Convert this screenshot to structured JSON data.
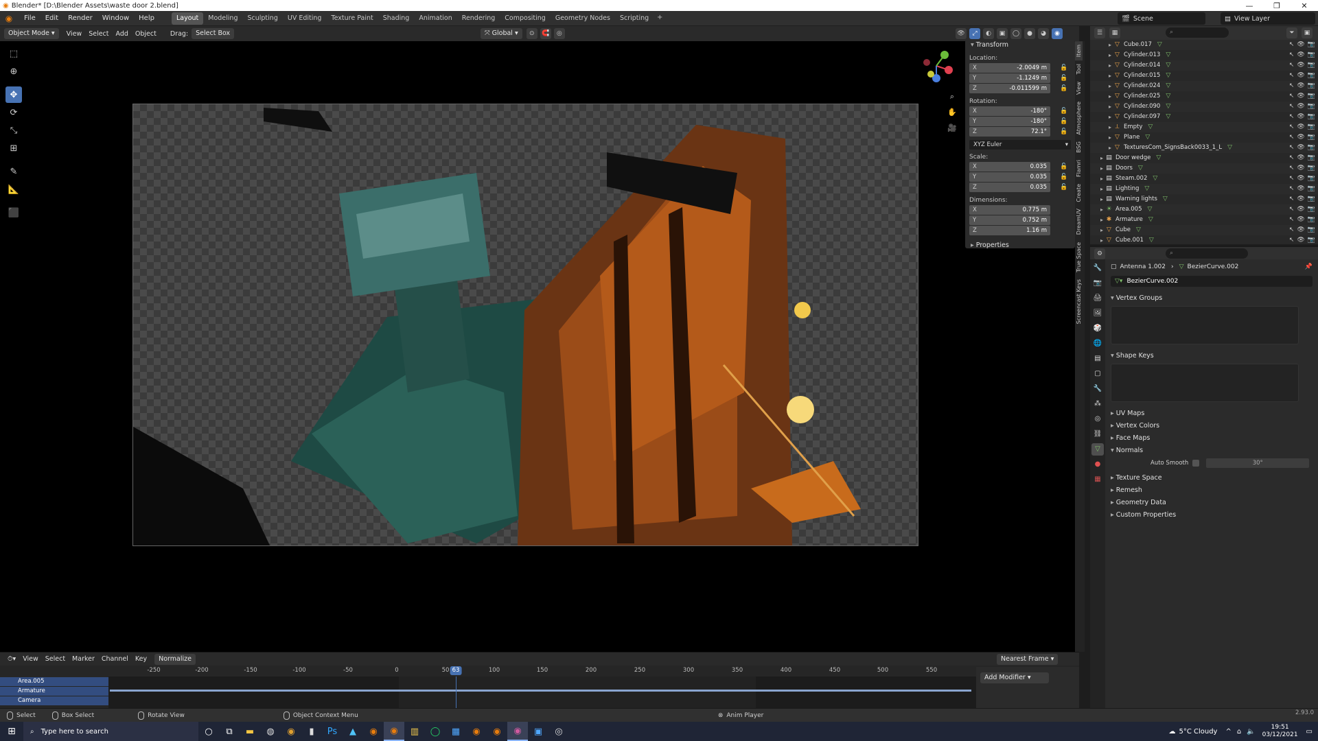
{
  "window": {
    "title": "Blender* [D:\\Blender Assets\\waste door 2.blend]",
    "controls": [
      "—",
      "❐",
      "✕"
    ]
  },
  "menu": [
    "File",
    "Edit",
    "Render",
    "Window",
    "Help"
  ],
  "workspaces": [
    "Layout",
    "Modeling",
    "Sculpting",
    "UV Editing",
    "Texture Paint",
    "Shading",
    "Animation",
    "Rendering",
    "Compositing",
    "Geometry Nodes",
    "Scripting"
  ],
  "active_workspace": "Layout",
  "scene": "Scene",
  "view_layer": "View Layer",
  "viewport_header": {
    "mode": "Object Mode",
    "view": "View",
    "select": "Select",
    "add": "Add",
    "object": "Object",
    "drag_label": "Drag:",
    "drag_value": "Select Box",
    "orientation": "Global"
  },
  "transform": {
    "title": "Transform",
    "location_label": "Location:",
    "location": [
      [
        "X",
        "-2.0049 m"
      ],
      [
        "Y",
        "-1.1249 m"
      ],
      [
        "Z",
        "-0.011599 m"
      ]
    ],
    "rotation_label": "Rotation:",
    "rotation": [
      [
        "X",
        "-180°"
      ],
      [
        "Y",
        "-180°"
      ],
      [
        "Z",
        "72.1°"
      ]
    ],
    "euler": "XYZ Euler",
    "scale_label": "Scale:",
    "scale": [
      [
        "X",
        "0.035"
      ],
      [
        "Y",
        "0.035"
      ],
      [
        "Z",
        "0.035"
      ]
    ],
    "dimensions_label": "Dimensions:",
    "dimensions": [
      [
        "X",
        "0.775 m"
      ],
      [
        "Y",
        "0.752 m"
      ],
      [
        "Z",
        "1.16 m"
      ]
    ],
    "properties": "Properties"
  },
  "side_tabs": [
    "Item",
    "Tool",
    "View",
    "Atmosphere",
    "BSG",
    "Flamri",
    "Create",
    "DreamUV",
    "True Space",
    "Screencast Keys"
  ],
  "timeline": {
    "menus": [
      "View",
      "Select",
      "Marker",
      "Channel",
      "Key"
    ],
    "normalize": "Normalize",
    "snap": "Nearest Frame",
    "ticks": [
      "-250",
      "-200",
      "-150",
      "-100",
      "-50",
      "0",
      "50",
      "100",
      "150",
      "200",
      "250",
      "300",
      "350",
      "400",
      "450",
      "500",
      "550"
    ],
    "current_frame": "63",
    "channels": [
      "Area.005",
      "Armature",
      "Camera"
    ],
    "add_modifier": "Add Modifier"
  },
  "status": {
    "select": "Select",
    "box_select": "Box Select",
    "rotate_view": "Rotate View",
    "context_menu": "Object Context Menu",
    "anim_player": "Anim Player",
    "version": "2.93.0"
  },
  "outliner": {
    "rows": [
      {
        "name": "Cube.017",
        "type": "obj",
        "indent": 2
      },
      {
        "name": "Cylinder.013",
        "type": "obj",
        "indent": 2
      },
      {
        "name": "Cylinder.014",
        "type": "obj",
        "indent": 2
      },
      {
        "name": "Cylinder.015",
        "type": "obj",
        "indent": 2
      },
      {
        "name": "Cylinder.024",
        "type": "obj",
        "indent": 2
      },
      {
        "name": "Cylinder.025",
        "type": "obj",
        "indent": 2
      },
      {
        "name": "Cylinder.090",
        "type": "obj",
        "indent": 2
      },
      {
        "name": "Cylinder.097",
        "type": "obj",
        "indent": 2
      },
      {
        "name": "Empty",
        "type": "empty",
        "indent": 2
      },
      {
        "name": "Plane",
        "type": "obj",
        "indent": 2
      },
      {
        "name": "TexturesCom_SignsBack0033_1_L",
        "type": "obj",
        "indent": 2
      },
      {
        "name": "Door wedge",
        "type": "coll",
        "indent": 1
      },
      {
        "name": "Doors",
        "type": "coll",
        "indent": 1
      },
      {
        "name": "Steam.002",
        "type": "coll",
        "indent": 1
      },
      {
        "name": "Lighting",
        "type": "coll",
        "indent": 1
      },
      {
        "name": "Warning lights",
        "type": "coll",
        "indent": 1
      },
      {
        "name": "Area.005",
        "type": "light",
        "indent": 1
      },
      {
        "name": "Armature",
        "type": "arm",
        "indent": 1
      },
      {
        "name": "Cube",
        "type": "obj",
        "indent": 1
      },
      {
        "name": "Cube.001",
        "type": "obj",
        "indent": 1
      }
    ]
  },
  "properties": {
    "object": "Antenna 1.002",
    "data": "BezierCurve.002",
    "mesh_name": "BezierCurve.002",
    "vertex_groups": "Vertex Groups",
    "shape_keys": "Shape Keys",
    "uv_maps": "UV Maps",
    "vertex_colors": "Vertex Colors",
    "face_maps": "Face Maps",
    "normals": "Normals",
    "auto_smooth": "Auto Smooth",
    "angle": "30°",
    "texture_space": "Texture Space",
    "remesh": "Remesh",
    "geometry_data": "Geometry Data",
    "custom_properties": "Custom Properties"
  },
  "taskbar": {
    "search": "Type here to search",
    "weather": "5°C  Cloudy",
    "time": "19:51",
    "date": "03/12/2021"
  },
  "colors": {
    "accent": "#4772b3",
    "blender_orange": "#e87d0d",
    "taskbar": "#1f2536"
  }
}
